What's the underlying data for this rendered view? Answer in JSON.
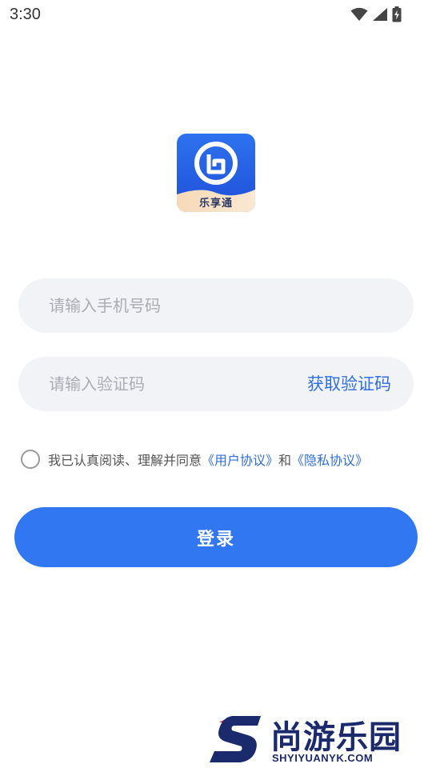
{
  "status_bar": {
    "time": "3:30",
    "icons": [
      "wifi-icon",
      "signal-icon",
      "battery-charging-icon"
    ]
  },
  "app": {
    "logo_name": "乐享通"
  },
  "form": {
    "phone_placeholder": "请输入手机号码",
    "phone_value": "",
    "code_placeholder": "请输入验证码",
    "code_value": "",
    "get_code_label": "获取验证码"
  },
  "agreement": {
    "checked": false,
    "prefix_text": "我已认真阅读、理解并同意",
    "user_agreement": "《用户协议》",
    "and_text": "和",
    "privacy_policy": "《隐私协议》"
  },
  "login_label": "登录",
  "watermark": {
    "title": "尚游乐园",
    "url": "SHYIYUANYK.COM"
  },
  "colors": {
    "primary": "#3077f1",
    "link": "#2f6fe0",
    "input_bg": "#f2f3f7",
    "placeholder": "#a9acb4",
    "watermark": "#1a2a6c",
    "watermark_accent": "#e02020"
  }
}
